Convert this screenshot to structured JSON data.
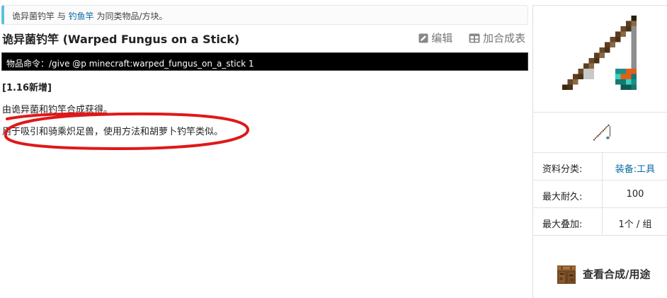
{
  "notice": {
    "part1": "诡异菌钓竿",
    "part2": " 与 ",
    "link": "钓鱼竿",
    "part3": " 为同类物品/方块。"
  },
  "page": {
    "title": "诡异菌钓竿 (Warped Fungus on a Stick)",
    "edit_label": "编辑",
    "recipe_table_label": "加合成表",
    "command": "物品命令：/give @p minecraft:warped_fungus_on_a_stick 1",
    "version": "[1.16新增]",
    "line1": "由诡异菌和钓竿合成获得。",
    "line2": "用于吸引和骑乘炽足兽，使用方法和胡萝卜钓竿类似。"
  },
  "infobox": {
    "rows": [
      {
        "label": "资料分类:",
        "value": "装备:工具"
      },
      {
        "label": "最大耐久:",
        "value": "100"
      },
      {
        "label": "最大叠加:",
        "value": "1个 / 组"
      }
    ],
    "recipe_label": "查看合成/用途"
  },
  "colors": {
    "accent_blue": "#5bc0de",
    "link": "#0b6aa2",
    "annotation_red": "#e01818"
  },
  "icons": [
    "pencil-icon",
    "table-icon",
    "fishing-rod-icon",
    "crafting-table-icon"
  ]
}
